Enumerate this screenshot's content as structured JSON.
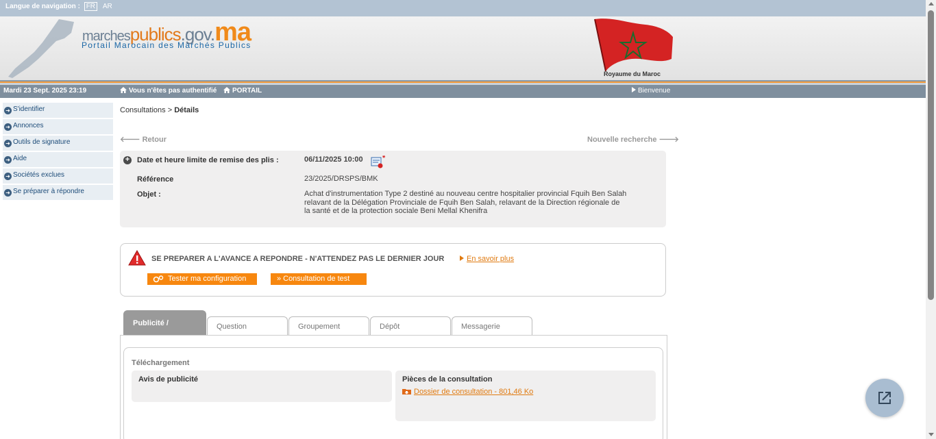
{
  "langbar": {
    "label": "Langue de navigation :",
    "lang_fr": "FR",
    "lang_ar": "AR"
  },
  "banner": {
    "logo": {
      "part1": "marches",
      "part2": "publics",
      "part3": ".gov.",
      "part4": "ma"
    },
    "subtitle": "Portail Marocain des Marchés Publics",
    "kingdom": "Royaume du Maroc"
  },
  "navbar": {
    "date": "Mardi 23 Sept. 2025 23:19",
    "auth": "Vous n'êtes pas authentifié",
    "portail": "PORTAIL",
    "welcome": "Bienvenue"
  },
  "menu": {
    "items": [
      {
        "label": "S'identifier"
      },
      {
        "label": "Annonces"
      },
      {
        "label": "Outils de signature"
      },
      {
        "label": "Aide"
      },
      {
        "label": "Sociétés exclues"
      },
      {
        "label": "Se préparer à répondre"
      }
    ]
  },
  "breadcrumb": {
    "part1": "Consultations > ",
    "part2": "Détails"
  },
  "nav_links": {
    "retour": "Retour",
    "new_search": "Nouvelle recherche"
  },
  "consultation": {
    "deadline_label": "Date et heure limite de remise des plis :",
    "deadline_value": "06/11/2025 10:00",
    "reference_label": "Référence",
    "reference_value": "23/2025/DRSPS/BMK",
    "objet_label": "Objet :",
    "objet_line1": "Achat d'instrumentation Type 2 destiné au nouveau centre hospitalier provincial Fquih Ben Salah",
    "objet_line2": "relavant de la Délégation Provinciale de Fquih Ben Salah, relavant de la Direction régionale de",
    "objet_line3": "la santé et de la protection sociale Beni Mellal Khenifra"
  },
  "prepare": {
    "title": "SE PREPARER A L'AVANCE A REPONDRE - N'ATTENDEZ PAS LE DERNIER JOUR",
    "link": "En savoir plus",
    "btn_test": "Tester ma configuration",
    "btn_consultation": "Consultation de test"
  },
  "tabs": [
    {
      "label": "Publicité /"
    },
    {
      "label": "Question"
    },
    {
      "label": "Groupement"
    },
    {
      "label": "Dépôt"
    },
    {
      "label": "Messagerie"
    }
  ],
  "download": {
    "title": "Téléchargement",
    "avis_title": "Avis de publicité",
    "pieces_title": "Pièces de la consultation",
    "dossier_link": "Dossier de consultation - 801,46 Ko"
  },
  "colors": {
    "accent_orange": "#f7870f",
    "nav_grey": "#7f8f9e",
    "link_blue": "#1c4b78",
    "brand_blue": "#1b67a6"
  }
}
